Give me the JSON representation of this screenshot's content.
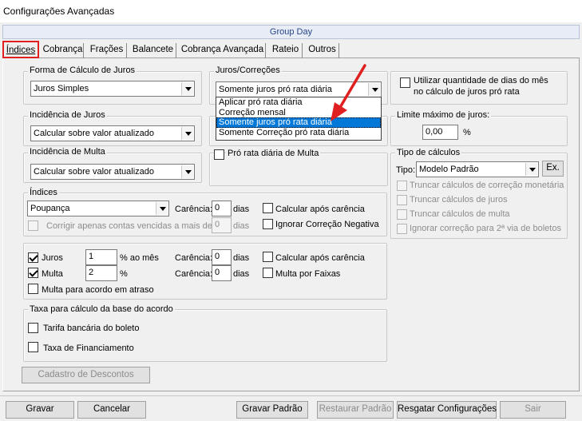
{
  "window": {
    "title": "Configurações Avançadas"
  },
  "group_header": "Group Day",
  "tabs": [
    "Índices",
    "Cobrança",
    "Frações",
    "Balancete",
    "Cobrança Avançada",
    "Rateio",
    "Outros"
  ],
  "forma_calculo": {
    "label": "Forma de Cálculo de Juros",
    "value": "Juros Simples"
  },
  "juros_correcoes": {
    "label": "Juros/Correções",
    "value": "Somente juros pró rata diária",
    "options": [
      "Aplicar pró rata diária",
      "Correção mensal",
      "Somente juros pró rata diária",
      "Somente Correção pró rata diária"
    ]
  },
  "utilizar_dias": {
    "label": "Utilizar quantidade de dias do mês no cálculo de juros pró rata",
    "line1": "Utilizar quantidade de dias do mês",
    "line2": "no cálculo de juros pró rata"
  },
  "incidencia_juros": {
    "label": "Incidência de Juros",
    "value": "Calcular sobre valor atualizado"
  },
  "limite_juros": {
    "label": "Limite máximo de juros:",
    "value": "0,00",
    "unit": "%"
  },
  "incidencia_multa": {
    "label": "Incidência de Multa",
    "value": "Calcular sobre valor atualizado"
  },
  "pro_rata_multa": {
    "label": "Pró rata diária de Multa"
  },
  "tipo_calculos": {
    "label": "Tipo de cálculos",
    "tipo_label": "Tipo:",
    "value": "Modelo Padrão",
    "ex_button": "Ex.",
    "options": [
      "Truncar cálculos de correção monetária",
      "Truncar cálculos de juros",
      "Truncar cálculos de multa",
      "Ignorar correção para 2ª via de boletos"
    ]
  },
  "indices": {
    "label": "Índices",
    "value": "Poupança",
    "carencia_label": "Carência:",
    "carencia_value": "0",
    "dias": "dias",
    "calc_apos_carencia": "Calcular após carência",
    "ignorar_correcao": "Ignorar Correção Negativa",
    "corrigir_label": "Corrigir apenas contas vencidas a mais de",
    "corrigir_value": "0",
    "corrigir_dias": "dias"
  },
  "juros_multa": {
    "juros_label": "Juros",
    "juros_value": "1",
    "juros_unit": "% ao mês",
    "multa_label": "Multa",
    "multa_value": "2",
    "multa_unit": "%",
    "carencia_label": "Carência:",
    "carencia_juros": "0",
    "carencia_multa": "0",
    "dias": "dias",
    "calc_apos_carencia": "Calcular após carência",
    "multa_faixas": "Multa por Faixas",
    "multa_acordo": "Multa para acordo em atraso"
  },
  "taxa_acordo": {
    "label": "Taxa para cálculo da base do acordo",
    "tarifa": "Tarifa bancária do boleto",
    "financiamento": "Taxa de Financiamento"
  },
  "cadastro_descontos": "Cadastro de Descontos",
  "buttons": {
    "gravar": "Gravar",
    "cancelar": "Cancelar",
    "gravar_padrao": "Gravar Padrão",
    "restaurar_padrao": "Restaurar Padrão",
    "resgatar": "Resgatar Configurações",
    "sair": "Sair"
  },
  "colors": {
    "accent_red": "#e02020",
    "selection_blue": "#0078d7",
    "group_header_text": "#26478a"
  }
}
